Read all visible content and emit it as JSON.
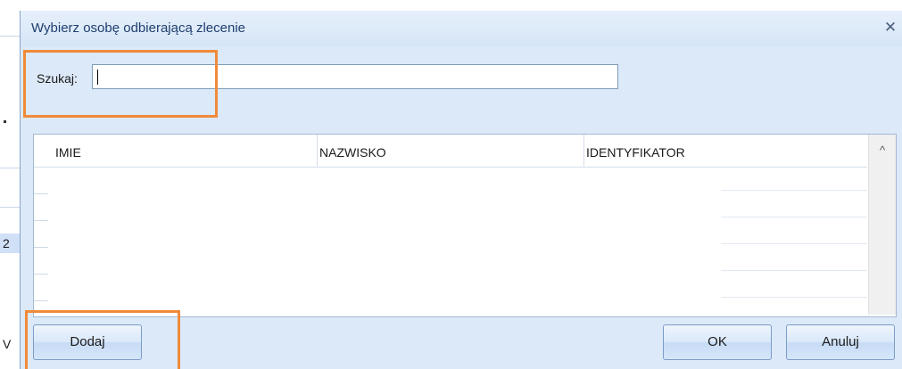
{
  "dialog": {
    "title": "Wybierz osobę odbierającą zlecenie",
    "close_icon": "close-icon"
  },
  "search": {
    "label": "Szukaj:",
    "value": "",
    "placeholder": ""
  },
  "table": {
    "columns": [
      "IMIE",
      "NAZWISKO",
      "IDENTYFIKATOR"
    ],
    "rows": []
  },
  "buttons": {
    "add": "Dodaj",
    "ok": "OK",
    "cancel": "Anuluj"
  },
  "background": {
    "glyph_1": "2",
    "glyph_2": "V"
  },
  "colors": {
    "highlight": "#f08a3a",
    "dialog_bg": "#dce9f8",
    "title_text": "#1f3f6e"
  }
}
